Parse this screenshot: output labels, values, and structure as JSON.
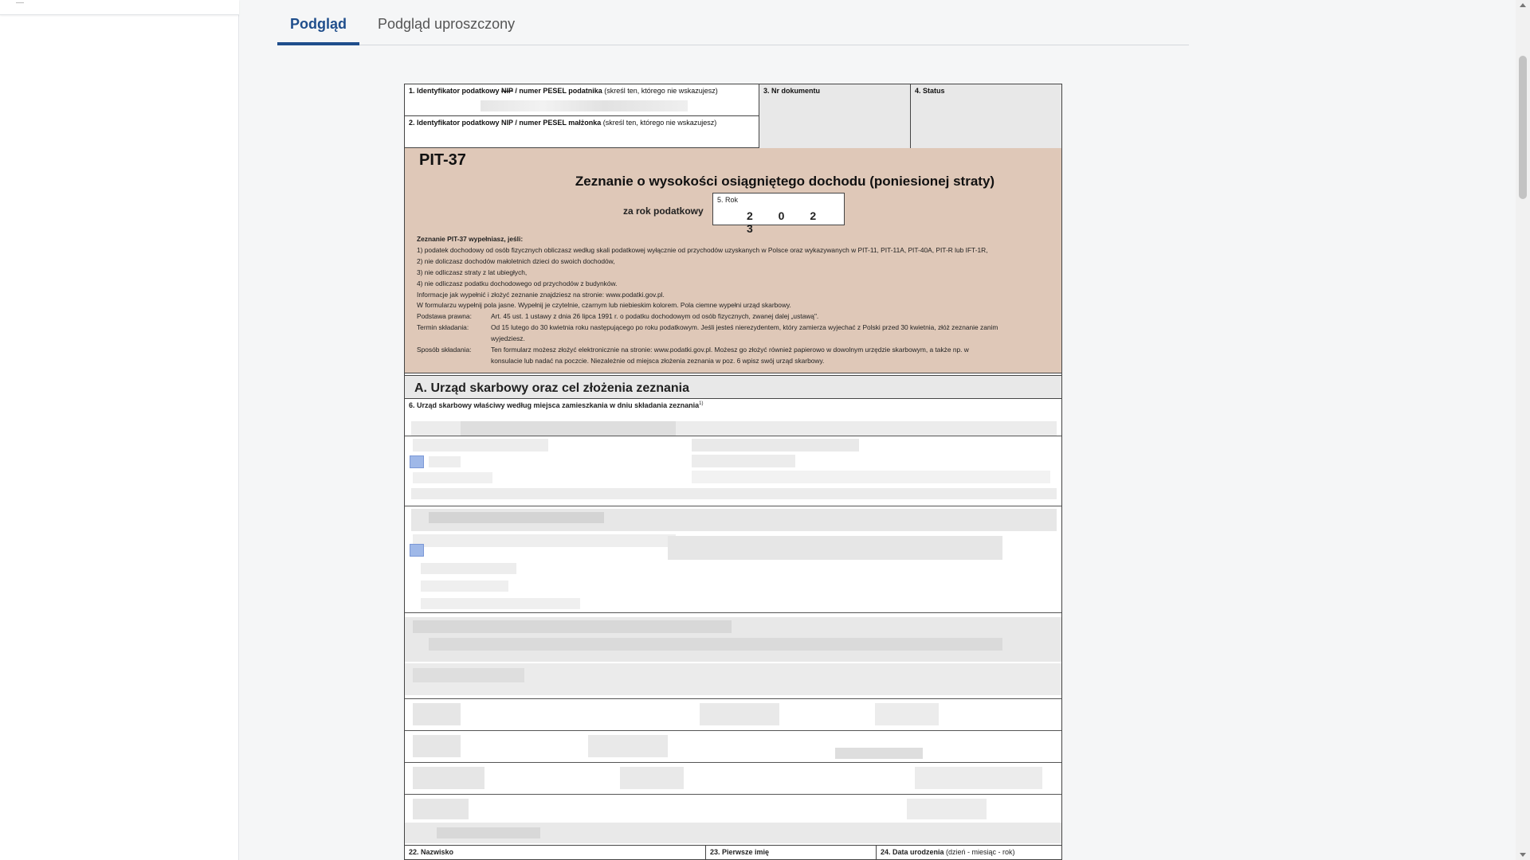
{
  "tabs": [
    {
      "label": "Podgląd",
      "active": true
    },
    {
      "label": "Podgląd uproszczony",
      "active": false
    }
  ],
  "form": {
    "header": {
      "field1": {
        "label_pre": "1. Identyfikator podatkowy ",
        "label_strike": "NIP",
        "label_post": " / numer PESEL podatnika",
        "note": " (skreśl ten, którego nie wskazujesz)"
      },
      "field2": {
        "label": "2. Identyfikator podatkowy NIP / numer PESEL małżonka",
        "note": " (skreśl ten, którego nie wskazujesz)"
      },
      "field3": "3. Nr dokumentu",
      "field4": "4. Status"
    },
    "code": "PIT-37",
    "title": "Zeznanie o wysokości osiągniętego dochodu (poniesionej straty)",
    "year_label": "za rok podatkowy",
    "year_field_label": "5. Rok",
    "year_value": "2 0 2 3",
    "instructions": {
      "head": "Zeznanie PIT-37 wypełniasz, jeśli:",
      "items": [
        "1) podatek dochodowy od osób fizycznych obliczasz według skali podatkowej wyłącznie od przychodów uzyskanych w Polsce oraz wykazywanych w PIT-11, PIT-11A, PIT-40A, PIT-R lub IFT-1R,",
        "2) nie doliczasz dochodów małoletnich dzieci do swoich dochodów,",
        "3) nie odliczasz straty z lat ubiegłych,",
        "4) nie odliczasz podatku dochodowego od przychodów z budynków."
      ],
      "info1": "Informacje jak wypełnić i złożyć zeznanie znajdziesz na stronie: www.podatki.gov.pl.",
      "info2": "W formularzu wypełnij pola jasne. Wypełnij je czytelnie, czarnym lub niebieskim kolorem. Pola ciemne wypełni urząd skarbowy.",
      "legal_key": "Podstawa prawna:",
      "legal_val": "Art. 45 ust. 1 ustawy z dnia 26 lipca 1991 r. o podatku dochodowym od osób fizycznych, zwanej dalej „ustawą\".",
      "deadline_key": "Termin składania:",
      "deadline_val": "Od 15 lutego do 30 kwietnia roku następującego po roku podatkowym. Jeśli jesteś nierezydentem, który zamierza wyjechać z Polski przed 30 kwietnia, złóż zeznanie zanim wyjedziesz.",
      "method_key": "Sposób składania:",
      "method_val": "Ten formularz możesz złożyć elektronicznie na stronie: www.podatki.gov.pl. Możesz go złożyć również papierowo w dowolnym urzędzie skarbowym, a także np. w konsulacie lub nadać na poczcie. Niezależnie od miejsca złożenia zeznania w poz. 6 wpisz swój urząd skarbowy."
    },
    "sectionA": "A.  Urząd skarbowy oraz cel złożenia zeznania",
    "field6_label": "6. Urząd skarbowy właściwy według miejsca zamieszkania w dniu składania zeznania",
    "field6_sup": "1)",
    "bottom": {
      "f22": "22. Nazwisko",
      "f23": "23. Pierwsze imię",
      "f24": "24. Data urodzenia",
      "f24_note": " (dzień - miesiąc - rok)"
    }
  },
  "colors": {
    "accent": "#1f4e8c",
    "form_title_bg": "#dfc8b8",
    "grey_field": "#e8e8e8"
  }
}
